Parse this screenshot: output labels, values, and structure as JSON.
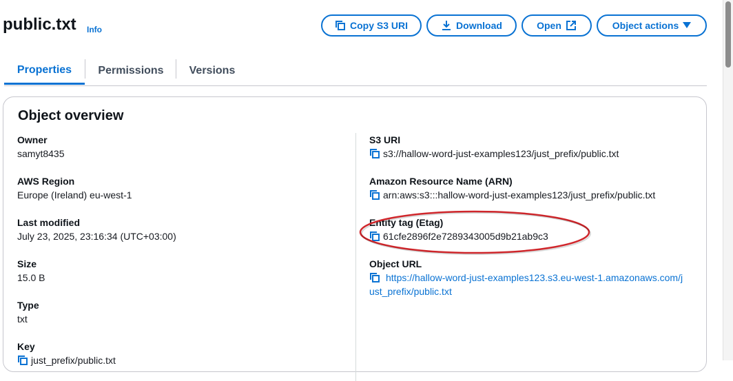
{
  "header": {
    "title": "public.txt",
    "info_label": "Info",
    "buttons": {
      "copy_s3_uri": "Copy S3 URI",
      "download": "Download",
      "open": "Open",
      "object_actions": "Object actions"
    }
  },
  "tabs": [
    {
      "label": "Properties",
      "active": true
    },
    {
      "label": "Permissions",
      "active": false
    },
    {
      "label": "Versions",
      "active": false
    }
  ],
  "overview": {
    "title": "Object overview",
    "left": {
      "owner": {
        "label": "Owner",
        "value": "samyt8435"
      },
      "region": {
        "label": "AWS Region",
        "value": "Europe (Ireland) eu-west-1"
      },
      "last_modified": {
        "label": "Last modified",
        "value": "July 23, 2025, 23:16:34 (UTC+03:00)"
      },
      "size": {
        "label": "Size",
        "value": "15.0 B"
      },
      "type": {
        "label": "Type",
        "value": "txt"
      },
      "key": {
        "label": "Key",
        "value": "just_prefix/public.txt"
      }
    },
    "right": {
      "s3_uri": {
        "label": "S3 URI",
        "value": "s3://hallow-word-just-examples123/just_prefix/public.txt"
      },
      "arn": {
        "label": "Amazon Resource Name (ARN)",
        "value": "arn:aws:s3:::hallow-word-just-examples123/just_prefix/public.txt"
      },
      "etag": {
        "label": "Entity tag (Etag)",
        "value": "61cfe2896f2e7289343005d9b21ab9c3"
      },
      "object_url": {
        "label": "Object URL",
        "value": "https://hallow-word-just-examples123.s3.eu-west-1.amazonaws.com/just_prefix/public.txt"
      }
    }
  },
  "colors": {
    "accent": "#0972d3",
    "annotation": "#d0262b"
  }
}
